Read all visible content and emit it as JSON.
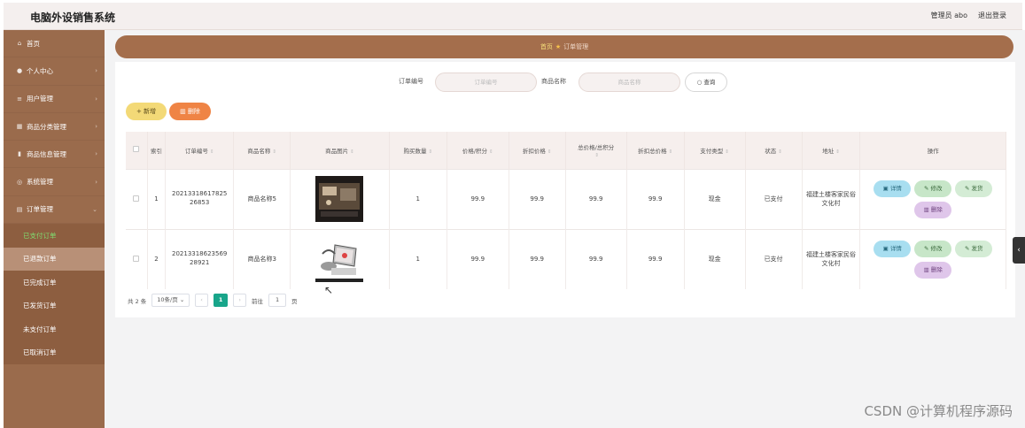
{
  "app": {
    "title": "电脑外设销售系统",
    "admin": "管理员 abo",
    "logout": "退出登录"
  },
  "sidebar": {
    "items": [
      {
        "label": "首页",
        "icon": "home-icon"
      },
      {
        "label": "个人中心",
        "icon": "user-icon"
      },
      {
        "label": "用户管理",
        "icon": "users-icon"
      },
      {
        "label": "商品分类管理",
        "icon": "category-icon"
      },
      {
        "label": "商品信息管理",
        "icon": "chart-icon"
      },
      {
        "label": "系统管理",
        "icon": "settings-icon"
      },
      {
        "label": "订单管理",
        "icon": "order-icon"
      }
    ],
    "subitems": [
      "已支付订单",
      "已退款订单",
      "已完成订单",
      "已发货订单",
      "未支付订单",
      "已取消订单"
    ]
  },
  "breadcrumb": {
    "home": "首页",
    "current": "订单管理"
  },
  "search": {
    "order_no_label": "订单编号",
    "order_no_placeholder": "订单编号",
    "product_label": "商品名称",
    "product_placeholder": "商品名称",
    "button": "查询"
  },
  "actions": {
    "add": "+ 新增",
    "delete": "删除"
  },
  "table": {
    "headers": [
      "索引",
      "订单编号",
      "商品名称",
      "商品图片",
      "购买数量",
      "价格/积分",
      "折扣价格",
      "总价格/总积分",
      "折扣总价格",
      "支付类型",
      "状态",
      "地址",
      "操作"
    ],
    "rows": [
      {
        "index": "1",
        "order_no": "2021331861782526853",
        "product": "商品名称5",
        "qty": "1",
        "price": "99.9",
        "discount": "99.9",
        "total": "99.9",
        "discount_total": "99.9",
        "pay": "现金",
        "status": "已支付",
        "address": "福建土楼客家民俗文化村"
      },
      {
        "index": "2",
        "order_no": "2021331862356928921",
        "product": "商品名称3",
        "qty": "1",
        "price": "99.9",
        "discount": "99.9",
        "total": "99.9",
        "discount_total": "99.9",
        "pay": "现金",
        "status": "已支付",
        "address": "福建土楼客家民俗文化村"
      }
    ],
    "ops": {
      "detail": "详情",
      "edit": "修改",
      "ship": "发货",
      "remove": "删除"
    }
  },
  "pager": {
    "total": "共 2 条",
    "size": "10条/页",
    "page": "1",
    "goto": "前往",
    "goto_value": "1",
    "page_unit": "页"
  },
  "watermark": "CSDN @计算机程序源码"
}
